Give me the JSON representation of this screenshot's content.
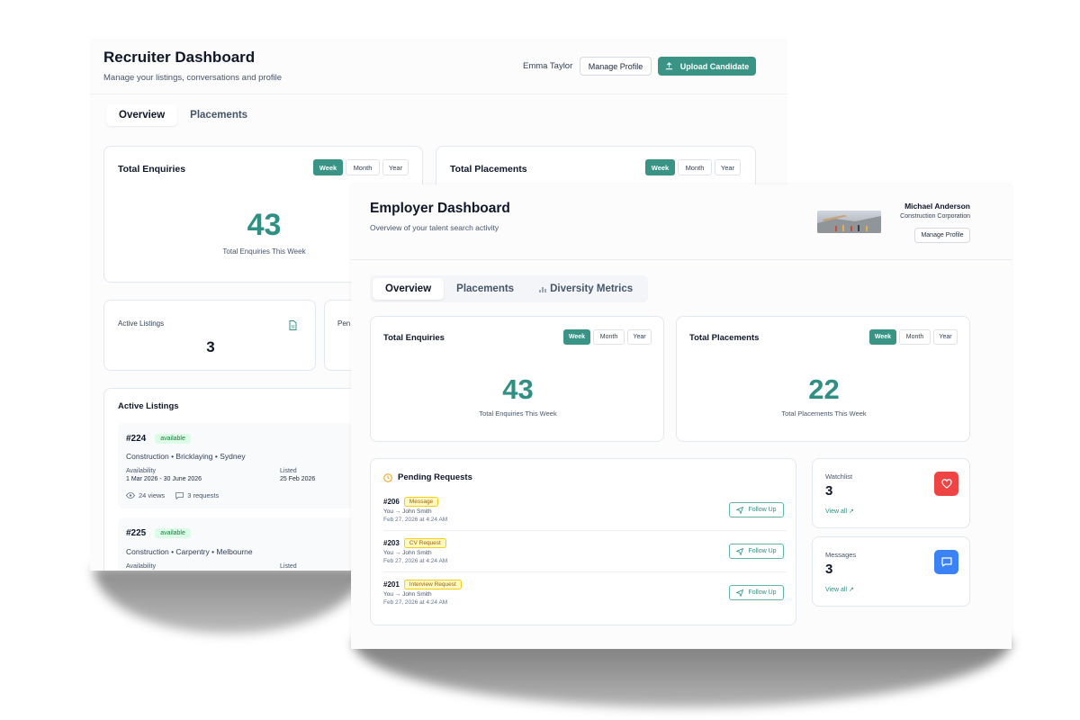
{
  "recruiter": {
    "title": "Recruiter Dashboard",
    "subtitle": "Manage your listings, conversations and profile",
    "user_name": "Emma Taylor",
    "manage_profile": "Manage Profile",
    "upload_candidate": "Upload Candidate",
    "tabs": [
      "Overview",
      "Placements"
    ],
    "enquiries": {
      "title": "Total Enquiries",
      "value": "43",
      "caption": "Total Enquiries This Week"
    },
    "placements": {
      "title": "Total Placements"
    },
    "periods": [
      "Week",
      "Month",
      "Year"
    ],
    "active_listings_card": {
      "label": "Active Listings",
      "value": "3"
    },
    "pending_partial": "Pen",
    "listings": {
      "title": "Active Listings",
      "items": [
        {
          "id": "#224",
          "status": "available",
          "category": "Construction • Bricklaying • Sydney",
          "availability_label": "Availability",
          "availability": "1 Mar 2026 - 30 June 2026",
          "listed_label": "Listed",
          "listed": "25 Feb 2026",
          "views": "24 views",
          "requests": "3 requests"
        },
        {
          "id": "#225",
          "status": "available",
          "category": "Construction • Carpentry • Melbourne",
          "availability_label": "Availability",
          "listed_label": "Listed"
        }
      ]
    }
  },
  "employer": {
    "title": "Employer Dashboard",
    "subtitle": "Overview of your talent search activity",
    "user_name": "Michael Anderson",
    "company": "Construction Corporation",
    "manage_profile": "Manage Profile",
    "tabs": [
      "Overview",
      "Placements",
      "Diversity Metrics"
    ],
    "periods": [
      "Week",
      "Month",
      "Year"
    ],
    "enquiries": {
      "title": "Total Enquiries",
      "value": "43",
      "caption": "Total Enquiries This Week"
    },
    "placements": {
      "title": "Total Placements",
      "value": "22",
      "caption": "Total Placements This Week"
    },
    "pending": {
      "title": "Pending Requests",
      "follow_up": "Follow Up",
      "items": [
        {
          "id": "#206",
          "type": "Message",
          "route": "You → John Smith",
          "time": "Feb 27, 2026 at 4:24 AM"
        },
        {
          "id": "#203",
          "type": "CV Request",
          "route": "You → John Smith",
          "time": "Feb 27, 2026 at 4:24 AM"
        },
        {
          "id": "#201",
          "type": "Interview Request",
          "route": "You → John Smith",
          "time": "Feb 27, 2026 at 4:24 AM"
        }
      ]
    },
    "watchlist": {
      "label": "Watchlist",
      "value": "3",
      "link": "View all ↗"
    },
    "messages": {
      "label": "Messages",
      "value": "3",
      "link": "View all ↗"
    }
  },
  "colors": {
    "accent": "#3a9486",
    "heart": "#ef4444",
    "message": "#3b82f6",
    "pending": "#f59e0b"
  }
}
